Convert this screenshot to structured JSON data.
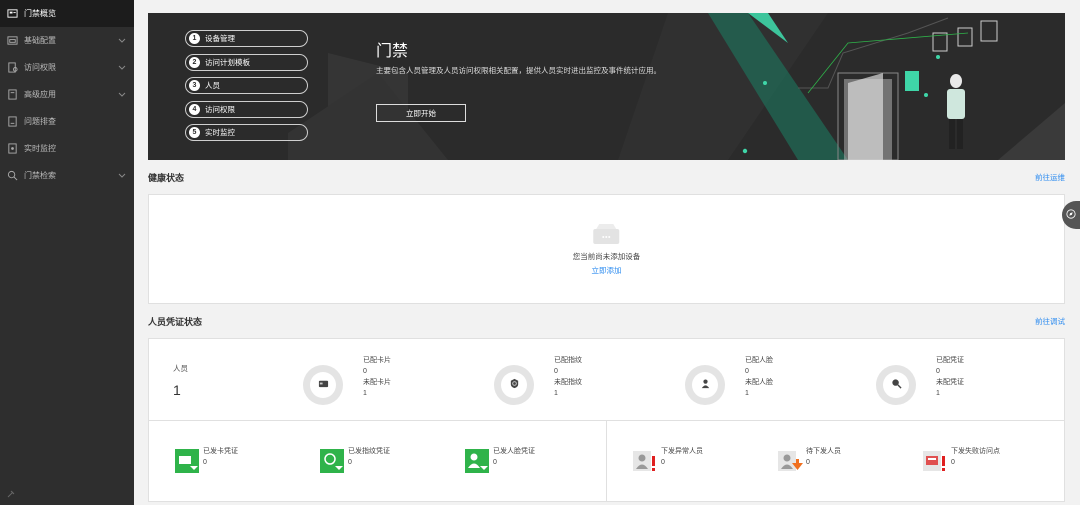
{
  "sidebar": {
    "items": [
      {
        "label": "门禁概览",
        "icon": "overview-icon",
        "active": true,
        "expandable": false
      },
      {
        "label": "基础配置",
        "icon": "config-icon",
        "active": false,
        "expandable": true
      },
      {
        "label": "访问权限",
        "icon": "access-icon",
        "active": false,
        "expandable": true
      },
      {
        "label": "高级应用",
        "icon": "advanced-icon",
        "active": false,
        "expandable": true
      },
      {
        "label": "问题排查",
        "icon": "troubleshoot-icon",
        "active": false,
        "expandable": false
      },
      {
        "label": "实时监控",
        "icon": "monitor-icon",
        "active": false,
        "expandable": false
      },
      {
        "label": "门禁检索",
        "icon": "search-icon",
        "active": false,
        "expandable": true
      }
    ],
    "pin_icon": "pin-icon"
  },
  "banner": {
    "steps": [
      {
        "num": "1",
        "label": "设备管理"
      },
      {
        "num": "2",
        "label": "访问计划模板"
      },
      {
        "num": "3",
        "label": "人员"
      },
      {
        "num": "4",
        "label": "访问权限"
      },
      {
        "num": "5",
        "label": "实时监控"
      }
    ],
    "title": "门禁",
    "description": "主要包含人员管理及人员访问权限相关配置，提供人员实时进出监控及事件统计应用。",
    "start_button": "立即开始"
  },
  "health": {
    "title": "健康状态",
    "link": "前往运维",
    "empty_message": "您当前尚未添加设备",
    "add_link": "立即添加"
  },
  "credential": {
    "title": "人员凭证状态",
    "link": "前往调试",
    "person_label": "人员",
    "person_count": "1",
    "stats": [
      {
        "icon": "card-icon",
        "assigned_label": "已配卡片",
        "assigned": "0",
        "unassigned_label": "未配卡片",
        "unassigned": "1"
      },
      {
        "icon": "fingerprint-icon",
        "assigned_label": "已配指纹",
        "assigned": "0",
        "unassigned_label": "未配指纹",
        "unassigned": "1"
      },
      {
        "icon": "face-icon",
        "assigned_label": "已配人脸",
        "assigned": "0",
        "unassigned_label": "未配人脸",
        "unassigned": "1"
      },
      {
        "icon": "credential-icon",
        "assigned_label": "已配凭证",
        "assigned": "0",
        "unassigned_label": "未配凭证",
        "unassigned": "1"
      }
    ],
    "issued": [
      {
        "icon": "issued-card-icon",
        "label": "已发卡凭证",
        "value": "0"
      },
      {
        "icon": "issued-fingerprint-icon",
        "label": "已发指纹凭证",
        "value": "0"
      },
      {
        "icon": "issued-face-icon",
        "label": "已发人脸凭证",
        "value": "0"
      }
    ],
    "issues": [
      {
        "icon": "abnormal-person-icon",
        "label": "下发异常人员",
        "value": "0"
      },
      {
        "icon": "pending-person-icon",
        "label": "待下发人员",
        "value": "0"
      },
      {
        "icon": "failed-visitor-icon",
        "label": "下发失败访问点",
        "value": "0"
      }
    ]
  },
  "colors": {
    "sidebar_bg": "#2e2e2e",
    "accent_green": "#2fb34a",
    "link_blue": "#2d8cf0",
    "alert_red": "#e02020",
    "pending_orange": "#f07020",
    "banner_teal": "#3fd6a8"
  }
}
